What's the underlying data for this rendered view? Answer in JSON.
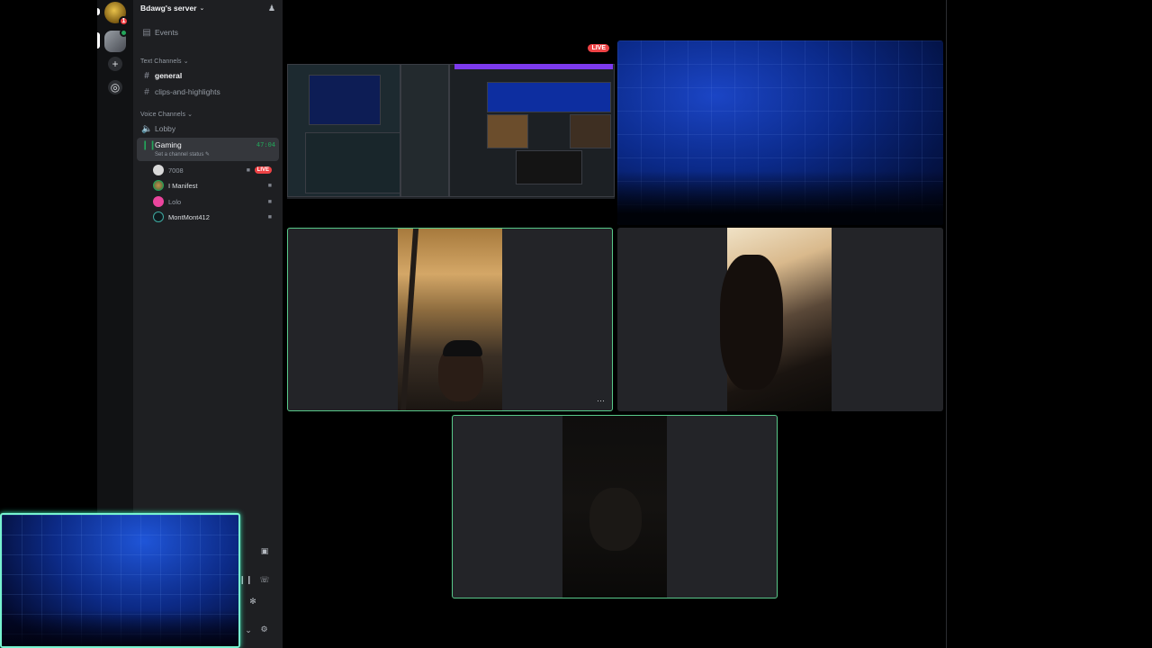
{
  "server": {
    "name": "Bdawg's server",
    "rail_badge": "1"
  },
  "sidebar": {
    "events_label": "Events",
    "text_category": "Text Channels",
    "text_channels": [
      {
        "name": "general"
      },
      {
        "name": "clips-and-highlights"
      }
    ],
    "voice_category": "Voice Channels",
    "voice_channels": [
      {
        "name": "Lobby"
      },
      {
        "name": "Gaming",
        "timer": "47:04",
        "status_placeholder": "Set a channel status"
      }
    ],
    "voice_users": [
      {
        "name": "7008",
        "live": "LIVE"
      },
      {
        "name": "I Manifest"
      },
      {
        "name": "Lolo"
      },
      {
        "name": "MontMont412"
      }
    ]
  },
  "stage": {
    "stream_live_label": "LIVE"
  },
  "colors": {
    "speaking_border": "#58c98a",
    "live_red": "#ed4245",
    "online_green": "#23a55a",
    "preview_glow": "#77f3d0"
  },
  "icons": {
    "events": "calendar-icon",
    "text_channel": "hash-icon",
    "voice_channel": "speaker-icon",
    "camera": "video-camera-icon",
    "invite": "add-member-icon",
    "settings": "gear-icon"
  }
}
